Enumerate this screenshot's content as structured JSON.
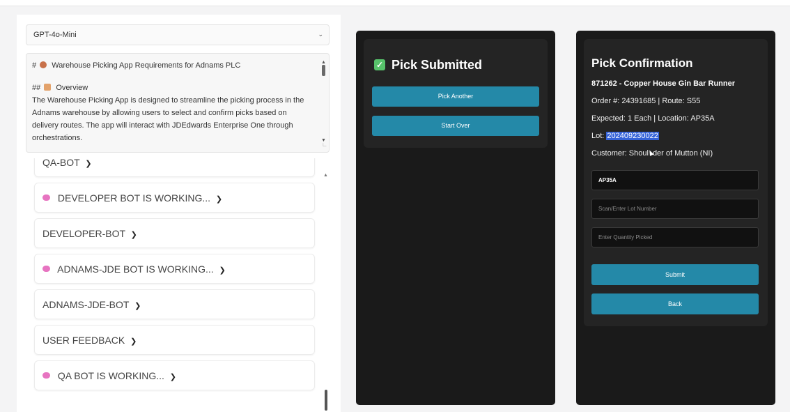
{
  "model_select": {
    "value": "GPT-4o-Mini"
  },
  "requirements": {
    "line1": "#",
    "line1_text": "Warehouse Picking App Requirements for Adnams PLC",
    "line2": "##",
    "line2_text": "Overview",
    "line3": "The Warehouse Picking App is designed to streamline the picking process in the",
    "line4": "Adnams warehouse by allowing users to select and confirm picks based on",
    "line5": "delivery routes. The app will interact with JDEdwards Enterprise One through",
    "line6": "orchestrations."
  },
  "bot_items": [
    {
      "label": "QA-BOT",
      "working": false
    },
    {
      "label": "DEVELOPER BOT IS WORKING...",
      "working": true
    },
    {
      "label": "DEVELOPER-BOT",
      "working": false
    },
    {
      "label": "ADNAMS-JDE BOT IS WORKING...",
      "working": true
    },
    {
      "label": "ADNAMS-JDE-BOT",
      "working": false
    },
    {
      "label": "USER FEEDBACK",
      "working": false
    },
    {
      "label": "QA BOT IS WORKING...",
      "working": true
    }
  ],
  "pick_submitted": {
    "title": "Pick Submitted",
    "pick_another_label": "Pick Another",
    "start_over_label": "Start Over"
  },
  "pick_confirmation": {
    "title": "Pick Confirmation",
    "item": "871262 - Copper House Gin Bar Runner",
    "order_line": "Order #: 24391685 | Route: S55",
    "expected_line": "Expected: 1 Each | Location: AP35A",
    "lot_prefix": "Lot: ",
    "lot_value": "202409230022",
    "customer_prefix": "Customer: Shoul",
    "customer_suffix": "der of Mutton (NI)",
    "location_value": "AP35A",
    "lot_placeholder": "Scan/Enter Lot Number",
    "qty_placeholder": "Enter Quantity Picked",
    "submit_label": "Submit",
    "back_label": "Back"
  },
  "colors": {
    "accent_button": "#2489a8",
    "phone_bg": "#1a1a1a",
    "working_dot": "#e774c1",
    "check_green": "#57c26b",
    "selection": "#3563d8"
  },
  "icons": {
    "select_chevron": "chevron-down-icon",
    "brain": "brain-icon",
    "document": "document-icon",
    "check": "checkmark-icon",
    "cursor": "mouse-cursor-icon"
  }
}
